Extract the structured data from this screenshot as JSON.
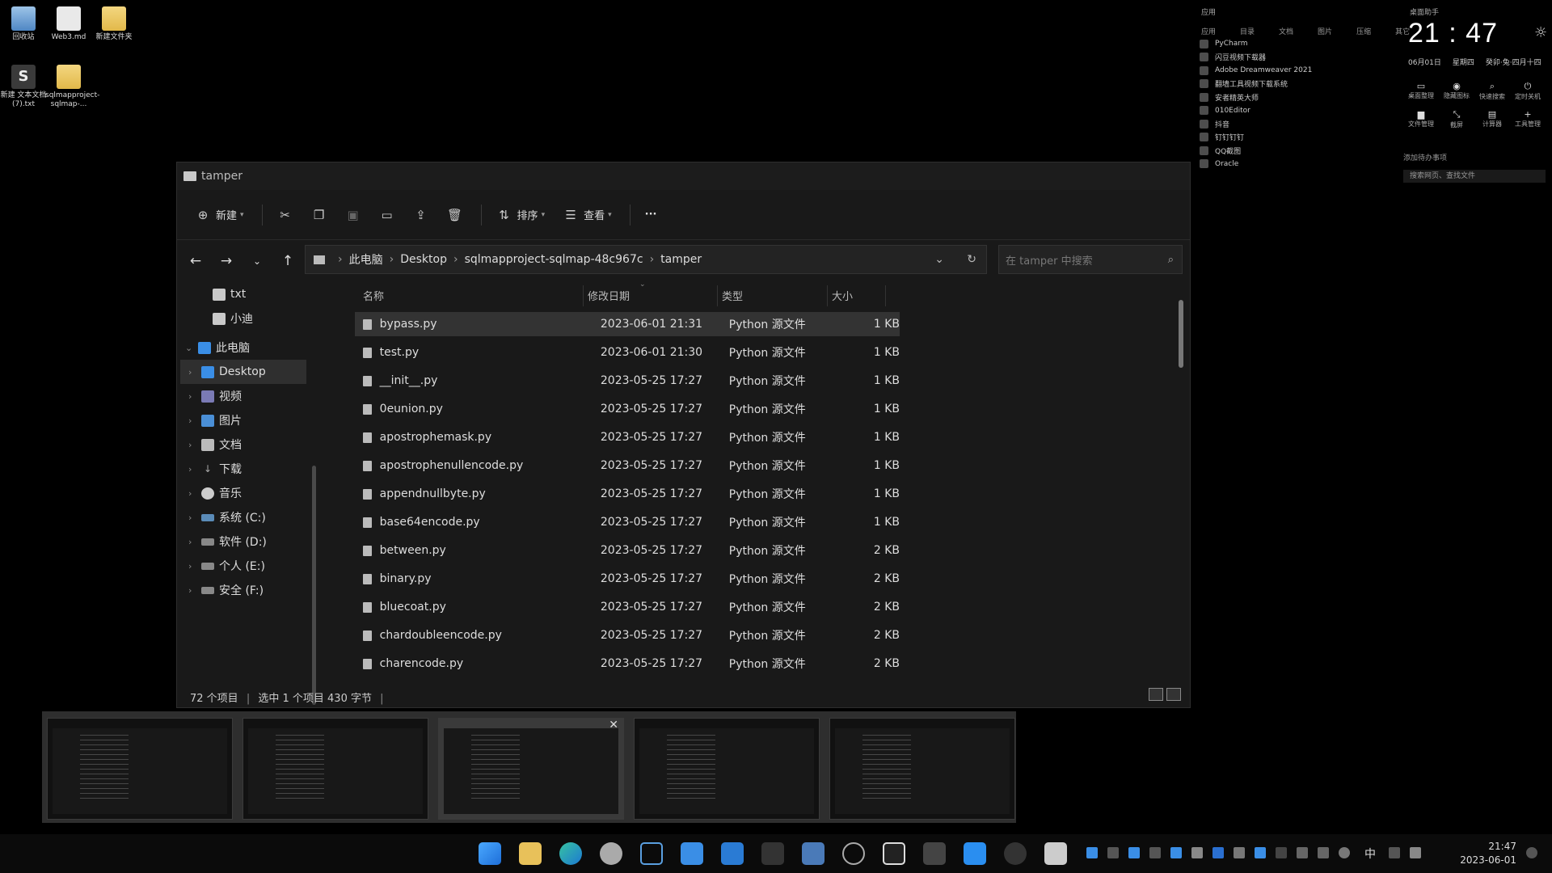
{
  "desktop": {
    "icons": [
      {
        "label": "回收站",
        "icon": "recycle-bin-icon"
      },
      {
        "label": "Web3.md",
        "icon": "file-icon"
      },
      {
        "label": "新建文件夹",
        "icon": "folder-icon"
      },
      {
        "label": "新建 文本文档 (7).txt",
        "icon": "sublime-file-icon"
      },
      {
        "label": "sqlmapproject-sqlmap-...",
        "icon": "folder-icon"
      }
    ]
  },
  "widget": {
    "header_left": "应用",
    "header_right": "桌面助手",
    "tabs": [
      "应用",
      "目录",
      "文档",
      "图片",
      "压缩",
      "其它"
    ],
    "apps": [
      "PyCharm",
      "闪豆视频下载器",
      "Adobe Dreamweaver 2021",
      "翻墙工具视频下载系统",
      "安者精英大师",
      "010Editor",
      "抖音",
      "钉钉钉钉",
      "QQ截图",
      "Oracle"
    ],
    "clock": "21 : 47",
    "date": "06月01日",
    "weekday": "星期四",
    "lunar": "癸卯·兔·四月十四",
    "quick_actions": [
      "桌面整理",
      "隐藏图标",
      "快速搜索",
      "定时关机",
      "文件管理",
      "截屏",
      "计算器",
      "工具管理"
    ],
    "todo_placeholder": "添加待办事项",
    "search_placeholder": "搜索网页、查找文件"
  },
  "window": {
    "title": "tamper",
    "toolbar": {
      "new_label": "新建",
      "sort_label": "排序",
      "view_label": "查看",
      "more_label": "···"
    },
    "breadcrumb": [
      "此电脑",
      "Desktop",
      "sqlmapproject-sqlmap-48c967c",
      "tamper"
    ],
    "search_placeholder": "在 tamper 中搜索",
    "sidebar": [
      {
        "label": "txt",
        "icon": "folder-icon",
        "indent": 2
      },
      {
        "label": "小迪",
        "icon": "folder-icon",
        "indent": 2
      },
      {
        "label": "此电脑",
        "icon": "computer-icon",
        "indent": 0,
        "expanded": true
      },
      {
        "label": "Desktop",
        "icon": "desktop-icon",
        "indent": 1,
        "selected": true
      },
      {
        "label": "视频",
        "icon": "video-icon",
        "indent": 1
      },
      {
        "label": "图片",
        "icon": "pictures-icon",
        "indent": 1
      },
      {
        "label": "文档",
        "icon": "documents-icon",
        "indent": 1
      },
      {
        "label": "下载",
        "icon": "download-icon",
        "indent": 1
      },
      {
        "label": "音乐",
        "icon": "music-icon",
        "indent": 1
      },
      {
        "label": "系统 (C:)",
        "icon": "drive-icon",
        "indent": 1
      },
      {
        "label": "软件 (D:)",
        "icon": "drive-icon",
        "indent": 1
      },
      {
        "label": "个人 (E:)",
        "icon": "drive-icon",
        "indent": 1
      },
      {
        "label": "安全 (F:)",
        "icon": "drive-icon",
        "indent": 1
      }
    ],
    "columns": {
      "name": "名称",
      "date": "修改日期",
      "type": "类型",
      "size": "大小"
    },
    "files": [
      {
        "name": "bypass.py",
        "date": "2023-06-01 21:31",
        "type": "Python 源文件",
        "size": "1 KB",
        "selected": true
      },
      {
        "name": "test.py",
        "date": "2023-06-01 21:30",
        "type": "Python 源文件",
        "size": "1 KB"
      },
      {
        "name": "__init__.py",
        "date": "2023-05-25 17:27",
        "type": "Python 源文件",
        "size": "1 KB"
      },
      {
        "name": "0eunion.py",
        "date": "2023-05-25 17:27",
        "type": "Python 源文件",
        "size": "1 KB"
      },
      {
        "name": "apostrophemask.py",
        "date": "2023-05-25 17:27",
        "type": "Python 源文件",
        "size": "1 KB"
      },
      {
        "name": "apostrophenullencode.py",
        "date": "2023-05-25 17:27",
        "type": "Python 源文件",
        "size": "1 KB"
      },
      {
        "name": "appendnullbyte.py",
        "date": "2023-05-25 17:27",
        "type": "Python 源文件",
        "size": "1 KB"
      },
      {
        "name": "base64encode.py",
        "date": "2023-05-25 17:27",
        "type": "Python 源文件",
        "size": "1 KB"
      },
      {
        "name": "between.py",
        "date": "2023-05-25 17:27",
        "type": "Python 源文件",
        "size": "2 KB"
      },
      {
        "name": "binary.py",
        "date": "2023-05-25 17:27",
        "type": "Python 源文件",
        "size": "2 KB"
      },
      {
        "name": "bluecoat.py",
        "date": "2023-05-25 17:27",
        "type": "Python 源文件",
        "size": "2 KB"
      },
      {
        "name": "chardoubleencode.py",
        "date": "2023-05-25 17:27",
        "type": "Python 源文件",
        "size": "2 KB"
      },
      {
        "name": "charencode.py",
        "date": "2023-05-25 17:27",
        "type": "Python 源文件",
        "size": "2 KB"
      }
    ],
    "status": {
      "item_count": "72 个项目",
      "selection": "选中 1 个项目  430 字节"
    }
  },
  "taskbar": {
    "time": "21:47",
    "date": "2023-06-01",
    "ime": "中",
    "apps": [
      "start-icon",
      "file-explorer-icon",
      "edge-icon",
      "chrome-icon",
      "task-view-icon",
      "store-icon",
      "photos-icon",
      "terminal-icon",
      "app-icon",
      "browser-icon",
      "pycharm-icon",
      "sublime-icon",
      "vscode-icon",
      "app-icon",
      "notepad-icon"
    ]
  },
  "colors": {
    "window_bg": "#191919",
    "selected_row": "#333333",
    "desktop_bg": "#000000"
  }
}
